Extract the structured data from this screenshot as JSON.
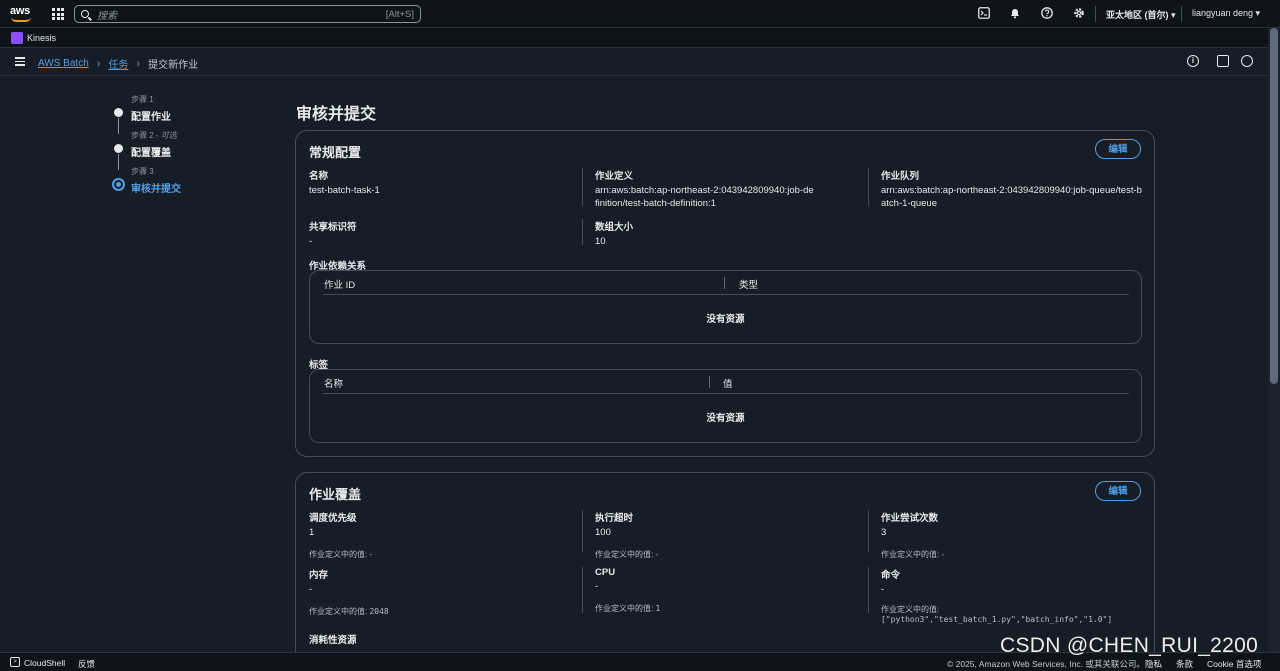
{
  "topnav": {
    "logo_text": "aws",
    "search_placeholder": "搜索",
    "search_shortcut": "[Alt+S]",
    "region": "亚太地区 (首尔) ▾",
    "user": "liangyuan deng ▾"
  },
  "service_bar": {
    "service": "Kinesis"
  },
  "breadcrumb": {
    "items": [
      "AWS Batch",
      "任务"
    ],
    "current": "提交新作业"
  },
  "steps": [
    {
      "label": "步骤 1",
      "optional": "",
      "name": "配置作业"
    },
    {
      "label": "步骤 2 - ",
      "optional": "可选",
      "name": "配置覆盖"
    },
    {
      "label": "步骤 3",
      "optional": "",
      "name": "审核并提交"
    }
  ],
  "page_title": "审核并提交",
  "general": {
    "title": "常规配置",
    "edit_label": "编辑",
    "name_key": "名称",
    "name_val": "test-batch-task-1",
    "jobdef_key": "作业定义",
    "jobdef_val": "arn:aws:batch:ap-northeast-2:043942809940:job-definition/test-batch-definition:1",
    "queue_key": "作业队列",
    "queue_val": "arn:aws:batch:ap-northeast-2:043942809940:job-queue/test-batch-1-queue",
    "share_key": "共享标识符",
    "share_val": "-",
    "array_key": "数组大小",
    "array_val": "10",
    "deps_label": "作业依赖关系",
    "deps_cols": [
      "作业 ID",
      "类型"
    ],
    "deps_empty": "没有资源",
    "tags_label": "标签",
    "tags_cols": [
      "名称",
      "值"
    ],
    "tags_empty": "没有资源"
  },
  "overrides": {
    "title": "作业覆盖",
    "edit_label": "编辑",
    "priority_key": "调度优先级",
    "priority_val": "1",
    "priority_def": "作业定义中的值: -",
    "timeout_key": "执行超时",
    "timeout_val": "100",
    "timeout_def": "作业定义中的值: -",
    "attempts_key": "作业尝试次数",
    "attempts_val": "3",
    "attempts_def": "作业定义中的值: -",
    "memory_key": "内存",
    "memory_val": "-",
    "memory_def_label": "作业定义中的值: ",
    "memory_def_val": "2048",
    "cpu_key": "CPU",
    "cpu_val": "-",
    "cpu_def_label": "作业定义中的值: ",
    "cpu_def_val": "1",
    "cmd_key": "命令",
    "cmd_val": "-",
    "cmd_def_label": "作业定义中的值:",
    "cmd_def_val": "[\"python3\",\"test_batch_1.py\",\"batch_info\",\"1.0\"]",
    "consumables_label": "消耗性资源"
  },
  "footer": {
    "cloudshell": "CloudShell",
    "feedback": "反馈",
    "copyright": "© 2025, Amazon Web Services, Inc. 或其关联公司。",
    "privacy": "隐私",
    "terms": "条款",
    "cookie": "Cookie 首选项"
  },
  "watermark": "CSDN @CHEN_RUI_2200",
  "colors": {
    "accent": "#539fe5",
    "bg": "#161d26",
    "nav": "#0f141b",
    "border": "#414d5c",
    "logo_orange": "#ff9900",
    "service_purple": "#8c4fff"
  }
}
